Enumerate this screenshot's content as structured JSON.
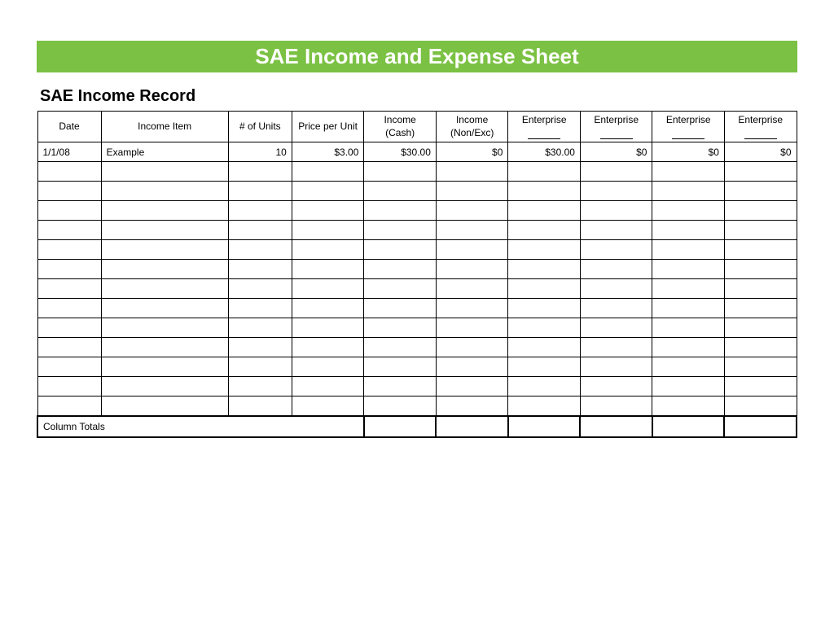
{
  "title": "SAE Income and Expense Sheet",
  "subtitle": "SAE Income Record",
  "headers": {
    "date": "Date",
    "income_item": "Income Item",
    "units": "# of Units",
    "price": "Price per Unit",
    "cash": "Income (Cash)",
    "nonexc": "Income (Non/Exc)",
    "ent1": "Enterprise",
    "ent2": "Enterprise",
    "ent3": "Enterprise",
    "ent4": "Enterprise"
  },
  "rows": [
    {
      "date": "1/1/08",
      "item": "Example",
      "units": "10",
      "price": "$3.00",
      "cash": "$30.00",
      "nonexc": "$0",
      "ent1": "$30.00",
      "ent2": "$0",
      "ent3": "$0",
      "ent4": "$0"
    }
  ],
  "empty_row_count": 13,
  "totals_label": "Column Totals"
}
